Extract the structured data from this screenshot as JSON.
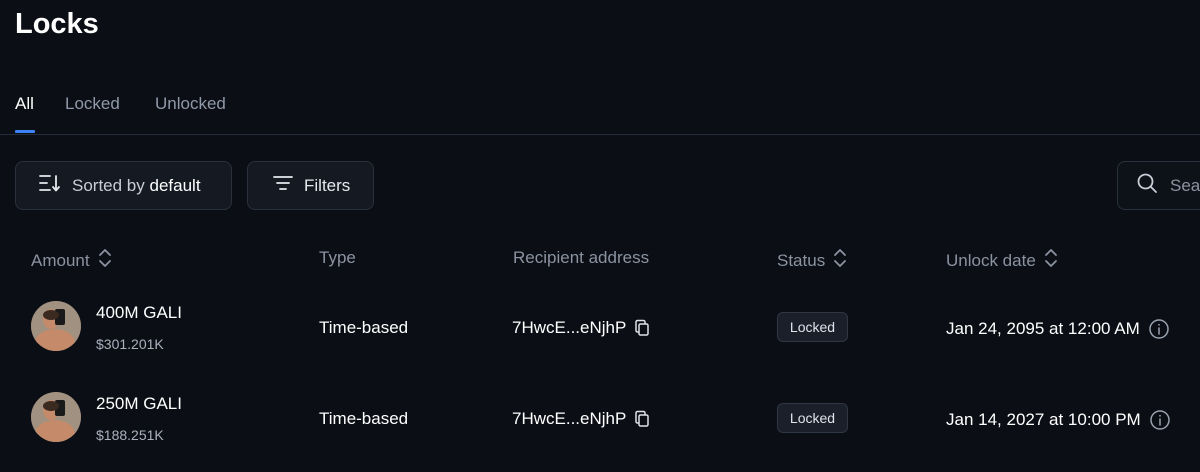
{
  "page": {
    "title": "Locks"
  },
  "tabs": [
    {
      "label": "All",
      "active": true
    },
    {
      "label": "Locked",
      "active": false
    },
    {
      "label": "Unlocked",
      "active": false
    }
  ],
  "toolbar": {
    "sort_prefix": "Sorted by",
    "sort_value": "default",
    "filters_label": "Filters",
    "search_placeholder": "Search"
  },
  "table": {
    "headers": {
      "amount": "Amount",
      "type": "Type",
      "recipient": "Recipient address",
      "status": "Status",
      "unlock_date": "Unlock date"
    },
    "rows": [
      {
        "amount": "400M GALI",
        "usd": "$301.201K",
        "type": "Time-based",
        "recipient": "7HwcE...eNjhP",
        "status": "Locked",
        "unlock_date": "Jan 24, 2095 at 12:00 AM"
      },
      {
        "amount": "250M GALI",
        "usd": "$188.251K",
        "type": "Time-based",
        "recipient": "7HwcE...eNjhP",
        "status": "Locked",
        "unlock_date": "Jan 14, 2027 at 10:00 PM"
      }
    ]
  },
  "colors": {
    "background": "#0b0e15",
    "accent": "#3b82f6",
    "muted_text": "#8b93a1"
  }
}
